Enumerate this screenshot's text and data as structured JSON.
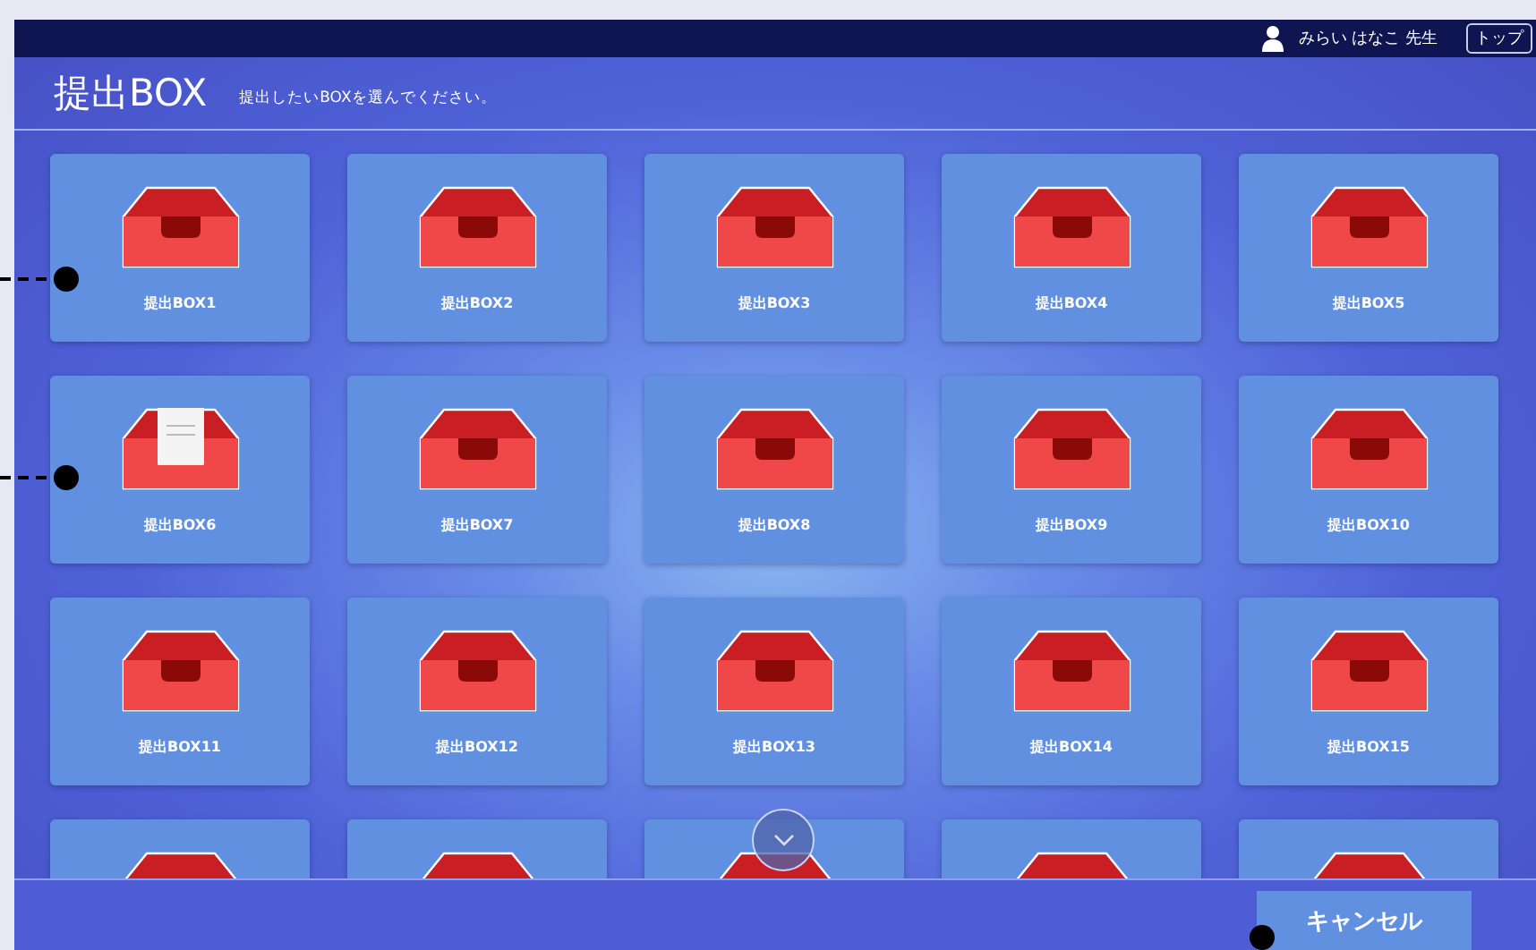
{
  "header": {
    "user_name": "みらい はなこ 先生",
    "top_button": "トップ"
  },
  "title": {
    "heading": "提出BOX",
    "instruction": "提出したいBOXを選んでください。"
  },
  "boxes": [
    {
      "label": "提出BOX1",
      "has_document": false
    },
    {
      "label": "提出BOX2",
      "has_document": false
    },
    {
      "label": "提出BOX3",
      "has_document": false
    },
    {
      "label": "提出BOX4",
      "has_document": false
    },
    {
      "label": "提出BOX5",
      "has_document": false
    },
    {
      "label": "提出BOX6",
      "has_document": true
    },
    {
      "label": "提出BOX7",
      "has_document": false
    },
    {
      "label": "提出BOX8",
      "has_document": false
    },
    {
      "label": "提出BOX9",
      "has_document": false
    },
    {
      "label": "提出BOX10",
      "has_document": false
    },
    {
      "label": "提出BOX11",
      "has_document": false
    },
    {
      "label": "提出BOX12",
      "has_document": false
    },
    {
      "label": "提出BOX13",
      "has_document": false
    },
    {
      "label": "提出BOX14",
      "has_document": false
    },
    {
      "label": "提出BOX15",
      "has_document": false
    },
    {
      "has_document": false
    },
    {
      "has_document": false
    },
    {
      "has_document": false
    },
    {
      "has_document": false
    },
    {
      "has_document": false
    }
  ],
  "footer": {
    "cancel_button": "キャンセル"
  }
}
